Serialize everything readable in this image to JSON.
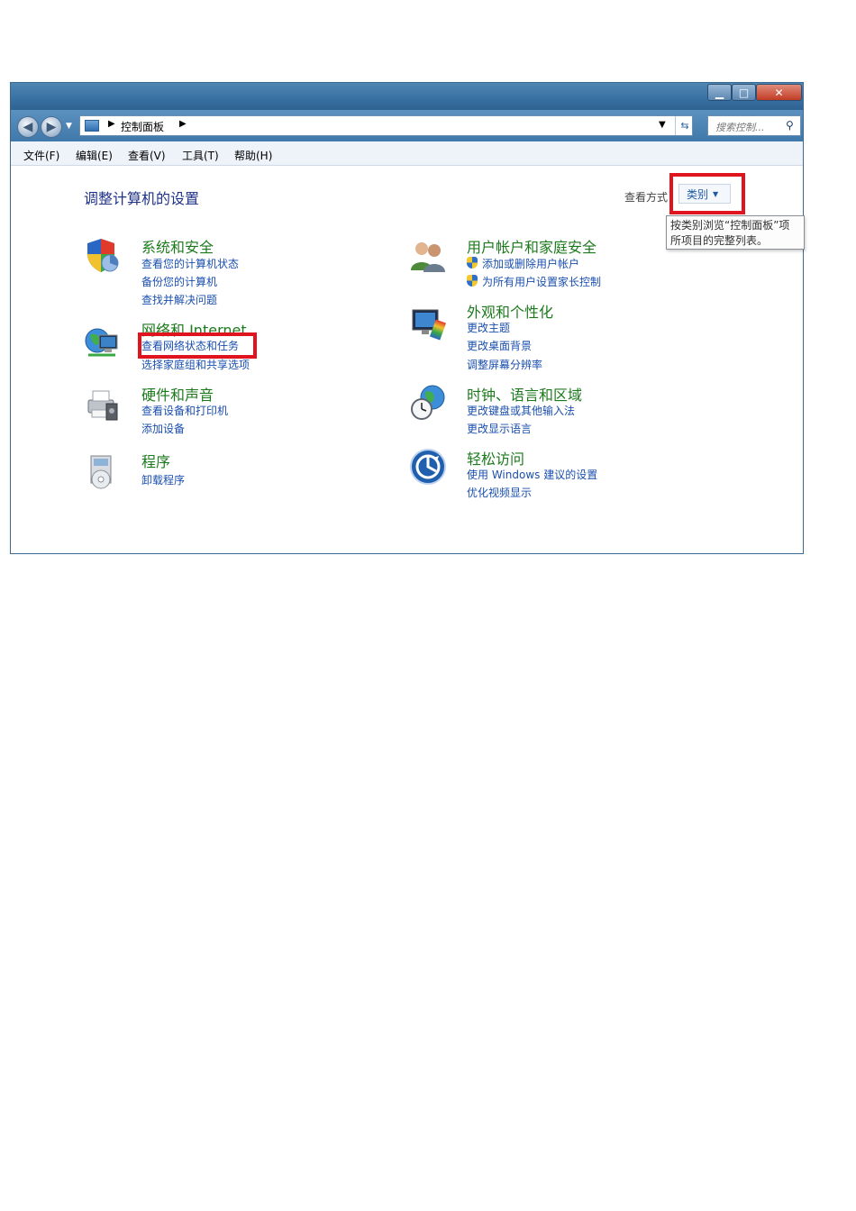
{
  "window": {
    "address": {
      "path": "控制面板"
    },
    "search": {
      "placeholder": "搜索控制..."
    },
    "menu": [
      "文件(F)",
      "编辑(E)",
      "查看(V)",
      "工具(T)",
      "帮助(H)"
    ]
  },
  "content": {
    "title": "调整计算机的设置",
    "view_by_label": "查看方式",
    "view_by_value": "类别",
    "tooltip_lines": [
      "按类别浏览“控制面板”项",
      "所项目的完整列表。"
    ]
  },
  "categories": [
    {
      "title": "系统和安全",
      "links": [
        "查看您的计算机状态",
        "备份您的计算机",
        "查找并解决问题"
      ],
      "icon": "shield-icon"
    },
    {
      "title": "网络和 Internet",
      "links": [
        "查看网络状态和任务",
        "选择家庭组和共享选项"
      ],
      "icon": "network-globe-icon"
    },
    {
      "title": "硬件和声音",
      "links": [
        "查看设备和打印机",
        "添加设备"
      ],
      "icon": "printer-icon"
    },
    {
      "title": "程序",
      "links": [
        "卸载程序"
      ],
      "icon": "programs-icon"
    },
    {
      "title": "用户帐户和家庭安全",
      "links": [
        "添加或删除用户帐户",
        "为所有用户设置家长控制"
      ],
      "icon": "users-icon"
    },
    {
      "title": "外观和个性化",
      "links": [
        "更改主题",
        "更改桌面背景",
        "调整屏幕分辨率"
      ],
      "icon": "monitor-icon"
    },
    {
      "title": "时钟、语言和区域",
      "links": [
        "更改键盘或其他输入法",
        "更改显示语言"
      ],
      "icon": "clock-globe-icon"
    },
    {
      "title": "轻松访问",
      "links": [
        "使用 Windows 建议的设置",
        "优化视频显示"
      ],
      "icon": "ease-of-access-icon"
    }
  ],
  "caption": {
    "left": "",
    "right": ""
  }
}
